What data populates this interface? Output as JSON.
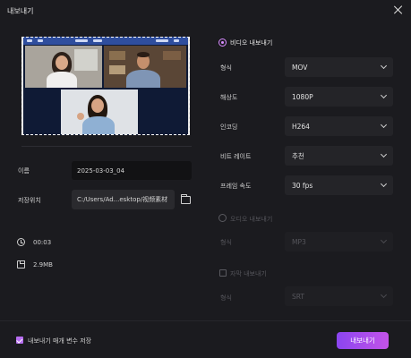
{
  "window": {
    "title": "내보내기"
  },
  "left": {
    "name_label": "이름",
    "name_value": "2025-03-03_04",
    "location_label": "저장위치",
    "location_value": "C:/Users/Ad...esktop/视频素材",
    "duration": "00:03",
    "size": "2.9MB"
  },
  "video_export": {
    "label": "비디오 내보내기",
    "rows": [
      {
        "label": "형식",
        "value": "MOV"
      },
      {
        "label": "해상도",
        "value": "1080P"
      },
      {
        "label": "인코딩",
        "value": "H264"
      },
      {
        "label": "비트 레이트",
        "value": "추천"
      },
      {
        "label": "프레임 속도",
        "value": "30  fps"
      }
    ]
  },
  "audio_export": {
    "label": "오디오 내보내기",
    "format_label": "형식",
    "format_value": "MP3"
  },
  "subtitle_export": {
    "label": "자막 내보내기",
    "format_label": "형식",
    "format_value": "SRT"
  },
  "footer": {
    "remember_label": "내보내기 매개 변수 저장",
    "export_button": "내보내기"
  },
  "colors": {
    "accent": "#b76ef0",
    "button_start": "#8b45f0",
    "button_end": "#c353e8"
  }
}
